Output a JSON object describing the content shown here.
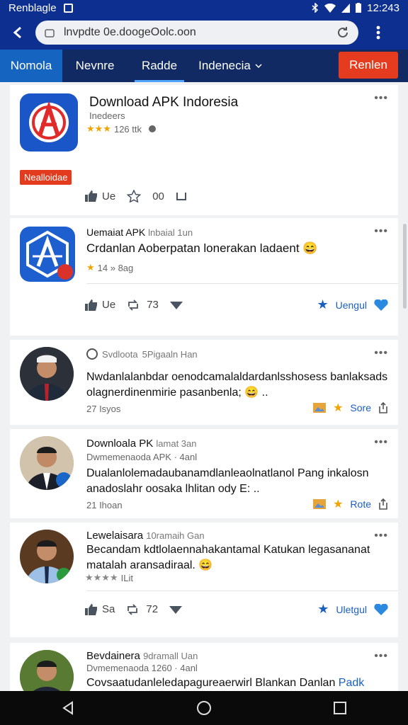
{
  "status": {
    "carrier": "Renblagle",
    "time": "12:243"
  },
  "browser": {
    "url": "lnvpdte 0e.doogeOolc.oon"
  },
  "tabs": {
    "t1": "Nomola",
    "t2": "Nevnre",
    "t3": "Radde",
    "t4": "Indenecia",
    "action": "Renlen"
  },
  "featured": {
    "title": "Download APK Indoresia",
    "publisher": "Inedeers",
    "rating_text": "126 ttk",
    "badge": "Nealloidae",
    "act1": "Ue",
    "act3": "00"
  },
  "post2": {
    "author": "Uemaiat APK",
    "meta": "lnbaial 1un",
    "text": "Crdanlan Aoberpatan lonerakan ladaent 😄",
    "rating_text": "14 » 8ag",
    "like": "Ue",
    "share": "73",
    "follow": "Uengul"
  },
  "post3": {
    "author": "Svdloota",
    "meta": "5Pigaaln Han",
    "text": "Nwdanlalanbdar oenodcamalaldardanlsshosess banlaksads olagnerdinenmirie pasanbenla; 😄 ..",
    "time": "27 Isyos",
    "save": "Sore"
  },
  "post4": {
    "author": "Downloala PK",
    "meta": "lamat 3an",
    "sub": "Dwmemenaoda APK · 4anl",
    "text": "Dualanlolemadaubanamdlanleaolnatlanol Pang inkalosn anadoslahr oosaka lhlitan ody E: ..",
    "time": "21 Ihoan",
    "save": "Rote"
  },
  "post5": {
    "author": "Lewelaisara",
    "meta": "10ramaih Gan",
    "text": "Becandam kdtlolaennahakantamal Katukan legasananat matalah aransadiraal. 😄",
    "rating_text": "ILit",
    "like": "Sa",
    "share": "72",
    "follow": "Uletgul"
  },
  "post6": {
    "author": "Bevdainera",
    "meta": "9dramall Uan",
    "sub": "Dvmemenaoda 1260 · 4anl",
    "text": "Covsaatudanleledapagureaerwirl Blankan Danlan",
    "link": "Padk"
  },
  "colors": {
    "header": "#0d2f8f",
    "tabbar": "#112a63",
    "accent": "#1565c0",
    "red": "#e53b1f"
  }
}
